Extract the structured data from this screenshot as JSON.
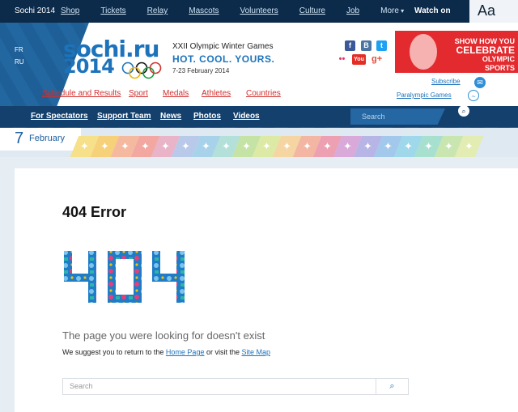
{
  "topbar": {
    "brand": "Sochi 2014",
    "links": [
      "Shop",
      "Tickets",
      "Relay",
      "Mascots",
      "Volunteers",
      "Culture",
      "Job",
      "More"
    ],
    "watch_on": "Watch on",
    "font_size_toggle": "Aa"
  },
  "languages": [
    "FR",
    "RU"
  ],
  "logo": {
    "line1": "sochi.ru",
    "line2": "2014"
  },
  "games": {
    "title": "XXII Olympic Winter Games",
    "slogan": "HOT. COOL. YOURS.",
    "dates": "7-23 February 2014"
  },
  "social": [
    {
      "name": "facebook-icon",
      "glyph": "f",
      "color": "#3b5998"
    },
    {
      "name": "vk-icon",
      "glyph": "B",
      "color": "#4c75a3"
    },
    {
      "name": "twitter-icon",
      "glyph": "t",
      "color": "#1da1f2"
    },
    {
      "name": "flickr-icon",
      "glyph": "••",
      "color": "#ffffff"
    },
    {
      "name": "youtube-icon",
      "glyph": "You",
      "color": "#e52d27"
    },
    {
      "name": "google-plus-icon",
      "glyph": "g+",
      "color": "#dd4b39"
    }
  ],
  "promo": {
    "line1": "SHOW HOW YOU",
    "line2": "CELEBRATE",
    "line3": "OLYMPIC SPORTS"
  },
  "main_nav": [
    "Schedule and Results",
    "Sport",
    "Medals",
    "Athletes",
    "Countries"
  ],
  "subscribe": "Subscribe",
  "paralympic": "Paralympic Games",
  "secondary_nav": [
    "For Spectators",
    "Support Team",
    "News",
    "Photos",
    "Videos"
  ],
  "nav_search_placeholder": "Search",
  "date": {
    "day": "7",
    "month": "February"
  },
  "sport_colors": [
    "#f6e08a",
    "#f7d07a",
    "#f5b9a0",
    "#f2a7a0",
    "#e9b3c8",
    "#b9c9ea",
    "#a8d2ea",
    "#b3e0d8",
    "#c6e3a6",
    "#ddeaa6",
    "#f5d6a3",
    "#f3b6a2",
    "#eca0b2",
    "#d8a9d9",
    "#b7b4e6",
    "#a2c8ec",
    "#9fd8ea",
    "#a8e0cf",
    "#c9e6b1",
    "#e3ecb2"
  ],
  "error": {
    "title": "404 Error",
    "big_code": "404",
    "message": "The page you were looking for doesn't exist",
    "suggest_prefix": "We suggest you to return to the ",
    "home_link": "Home Page",
    "suggest_middle": " or visit the ",
    "sitemap_link": "Site Map"
  },
  "bottom_search_placeholder": "Search"
}
